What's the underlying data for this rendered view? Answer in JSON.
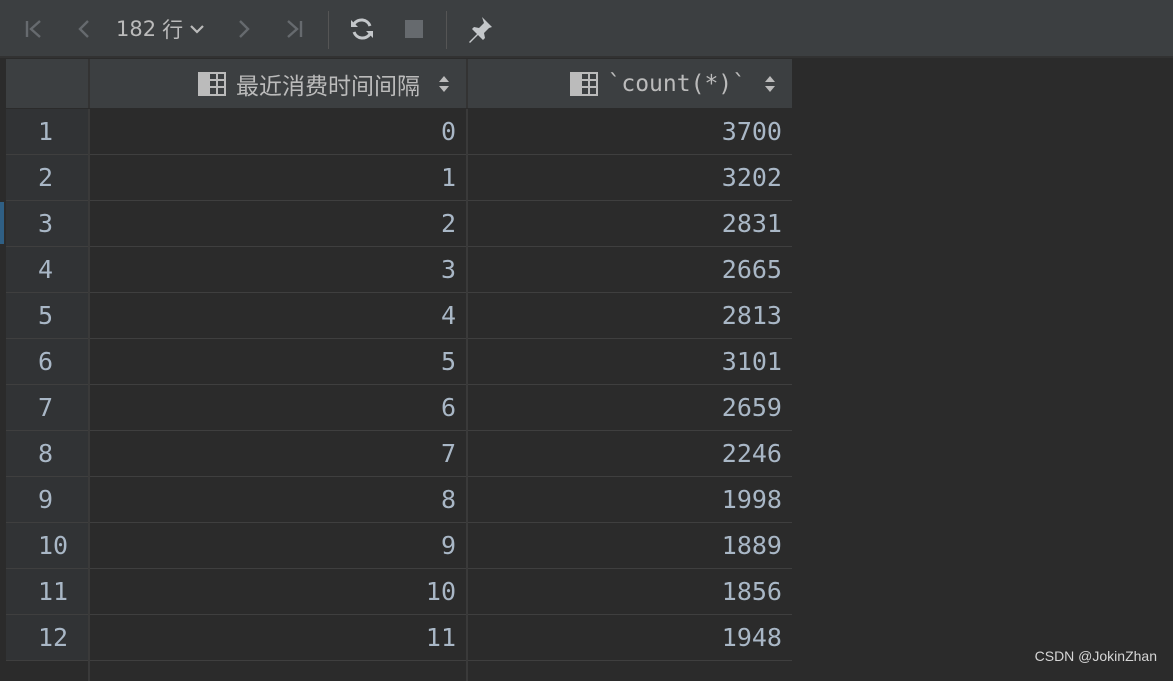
{
  "toolbar": {
    "row_count": "182",
    "row_unit": "行",
    "icons": [
      "first-page-icon",
      "previous-page-icon",
      "chevron-down-icon",
      "next-page-icon",
      "last-page-icon",
      "refresh-icon",
      "stop-icon",
      "pin-icon"
    ]
  },
  "columns": [
    {
      "label": "最近消费时间间隔",
      "icon": "table-column-icon"
    },
    {
      "label": "`count(*)`",
      "icon": "table-column-icon"
    }
  ],
  "rows": [
    {
      "n": "1",
      "a": "0",
      "b": "3700"
    },
    {
      "n": "2",
      "a": "1",
      "b": "3202"
    },
    {
      "n": "3",
      "a": "2",
      "b": "2831"
    },
    {
      "n": "4",
      "a": "3",
      "b": "2665"
    },
    {
      "n": "5",
      "a": "4",
      "b": "2813"
    },
    {
      "n": "6",
      "a": "5",
      "b": "3101"
    },
    {
      "n": "7",
      "a": "6",
      "b": "2659"
    },
    {
      "n": "8",
      "a": "7",
      "b": "2246"
    },
    {
      "n": "9",
      "a": "8",
      "b": "1998"
    },
    {
      "n": "10",
      "a": "9",
      "b": "1889"
    },
    {
      "n": "11",
      "a": "10",
      "b": "1856"
    },
    {
      "n": "12",
      "a": "11",
      "b": "1948"
    }
  ],
  "watermark": "CSDN @JokinZhan"
}
